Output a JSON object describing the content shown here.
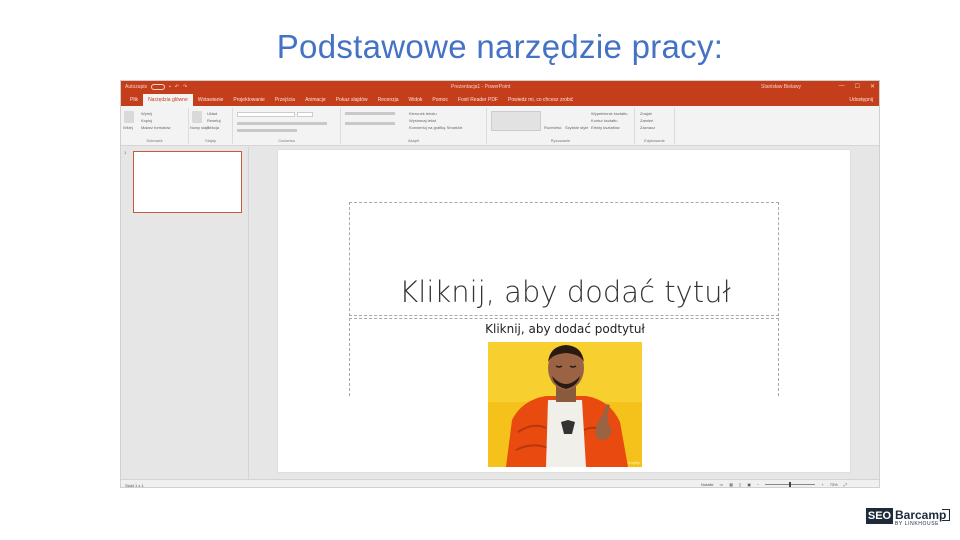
{
  "heading": "Podstawowe narzędzie pracy:",
  "window": {
    "autosave_label": "Autozapis",
    "doc_title": "Prezentacja1 - PowerPoint",
    "user_name": "Stanisław Bielawy",
    "min_icon": "—",
    "max_icon": "☐",
    "close_icon": "✕"
  },
  "tabs": [
    "Plik",
    "Narzędzia główne",
    "Wstawianie",
    "Projektowanie",
    "Przejścia",
    "Animacje",
    "Pokaz slajdów",
    "Recenzja",
    "Widok",
    "Pomoc",
    "Foxit Reader PDF",
    "Powiedz mi, co chcesz zrobić"
  ],
  "share_label": "Udostępnij",
  "ribbon": {
    "paste_label": "Wklej",
    "cut_label": "Wytnij",
    "copy_label": "Kopiuj",
    "format_painter_label": "Malarz formatów",
    "new_slide_label": "Nowy slajd",
    "layout_label": "Układ",
    "reset_label": "Resetuj",
    "section_label": "Sekcja",
    "arrange_label": "Rozmieść",
    "quick_styles_label": "Szybkie style",
    "shape_fill_label": "Wypełnienie kształtu",
    "shape_outline_label": "Kontur kształtu",
    "shape_effects_label": "Efekty kształtów",
    "find_label": "Znajdź",
    "replace_label": "Zamień",
    "select_label": "Zaznacz",
    "text_direction_label": "Kierunek tekstu",
    "align_text_label": "Wyrównaj tekst",
    "smartart_label": "Konwertuj na grafikę SmartArt",
    "groups": [
      "Schowek",
      "Slajdy",
      "Czcionka",
      "Akapit",
      "Rysowanie",
      "Edytowanie"
    ]
  },
  "slide": {
    "number": "1",
    "title_placeholder": "Kliknij, aby dodać tytuł",
    "subtitle_placeholder": "Kliknij, aby dodać podtytuł",
    "image_watermark": "imgflip"
  },
  "status": {
    "slide_info": "Slajd 1 z 1",
    "notes_label": "Notatki",
    "zoom": "73%"
  },
  "logo": {
    "seo": "SEO",
    "barcamp": "Barcamp",
    "by": "BY LINKHOUSE"
  }
}
